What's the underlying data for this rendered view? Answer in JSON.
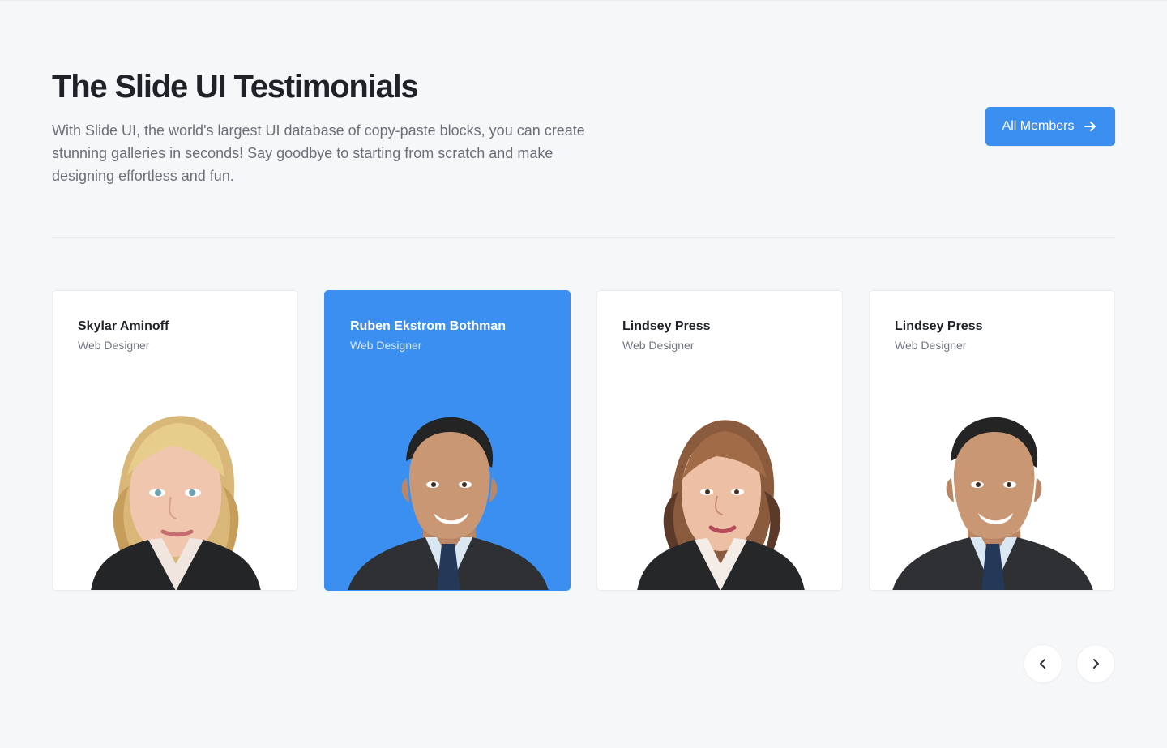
{
  "header": {
    "title": "The Slide UI Testimonials",
    "description": "With Slide UI, the world's largest UI database of copy-paste blocks, you can create stunning galleries in seconds! Say goodbye to starting from scratch and make designing effortless and fun.",
    "button_label": "All Members",
    "button_icon": "arrow-right-icon"
  },
  "members": [
    {
      "name": "Skylar Aminoff",
      "role": "Web Designer",
      "highlighted": false,
      "portrait": "blonde-woman-portrait"
    },
    {
      "name": "Ruben Ekstrom Bothman",
      "role": "Web Designer",
      "highlighted": true,
      "portrait": "man-portrait"
    },
    {
      "name": "Lindsey Press",
      "role": "Web Designer",
      "highlighted": false,
      "portrait": "brunette-woman-portrait"
    },
    {
      "name": "Lindsey Press",
      "role": "Web Designer",
      "highlighted": false,
      "portrait": "man-portrait"
    }
  ],
  "carousel_controls": {
    "previous_icon": "chevron-left-icon",
    "next_icon": "chevron-right-icon"
  },
  "colors": {
    "background": "#f6f7f9",
    "accent": "#3b8ff0",
    "card": "#ffffff",
    "title": "#1f2328",
    "muted_text": "#6b7078"
  }
}
